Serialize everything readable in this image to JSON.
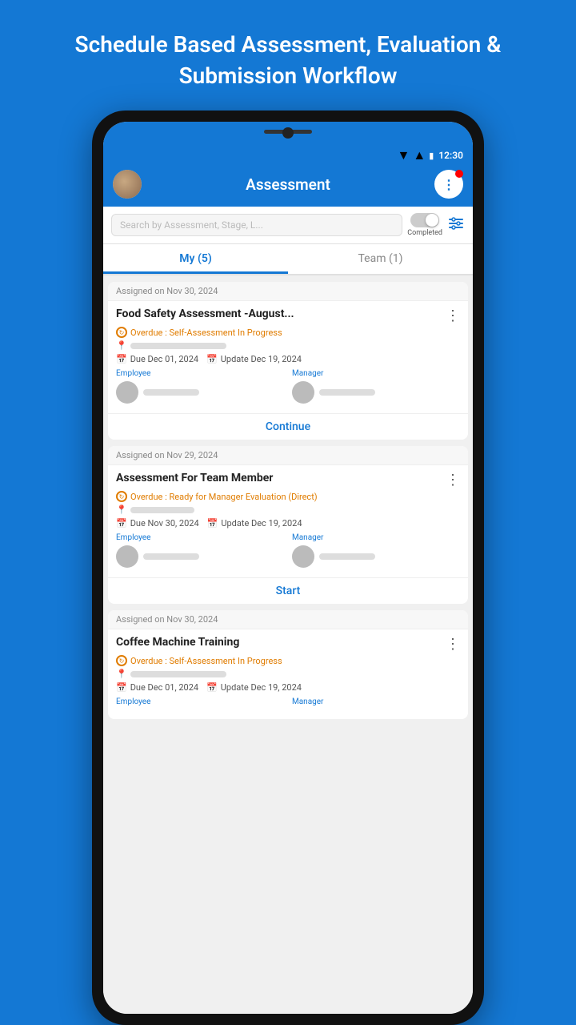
{
  "hero": {
    "title": "Schedule Based Assessment, Evaluation & Submission Workflow"
  },
  "status_bar": {
    "time": "12:30",
    "wifi": "▼",
    "signal": "▲",
    "battery": "▮"
  },
  "header": {
    "title": "Assessment",
    "more_dots": "⋮"
  },
  "search": {
    "placeholder": "Search by Assessment, Stage, L...",
    "toggle_label": "Completed",
    "filter_icon": "⊟"
  },
  "tabs": [
    {
      "label": "My (5)",
      "active": true
    },
    {
      "label": "Team (1)",
      "active": false
    }
  ],
  "cards": [
    {
      "assigned": "Assigned on Nov 30, 2024",
      "title": "Food Safety Assessment -August...",
      "status": "Overdue : Self-Assessment In Progress",
      "due": "Due Dec 01, 2024",
      "update": "Update Dec 19, 2024",
      "employee_label": "Employee",
      "manager_label": "Manager",
      "action": "Continue"
    },
    {
      "assigned": "Assigned on Nov 29, 2024",
      "title": "Assessment For Team Member",
      "status": "Overdue : Ready for Manager Evaluation (Direct)",
      "due": "Due Nov 30, 2024",
      "update": "Update Dec 19, 2024",
      "employee_label": "Employee",
      "manager_label": "Manager",
      "action": "Start"
    },
    {
      "assigned": "Assigned on Nov 30, 2024",
      "title": "Coffee Machine Training",
      "status": "Overdue : Self-Assessment In Progress",
      "due": "Due Dec 01, 2024",
      "update": "Update Dec 19, 2024",
      "employee_label": "Employee",
      "manager_label": "Manager",
      "action": ""
    }
  ]
}
